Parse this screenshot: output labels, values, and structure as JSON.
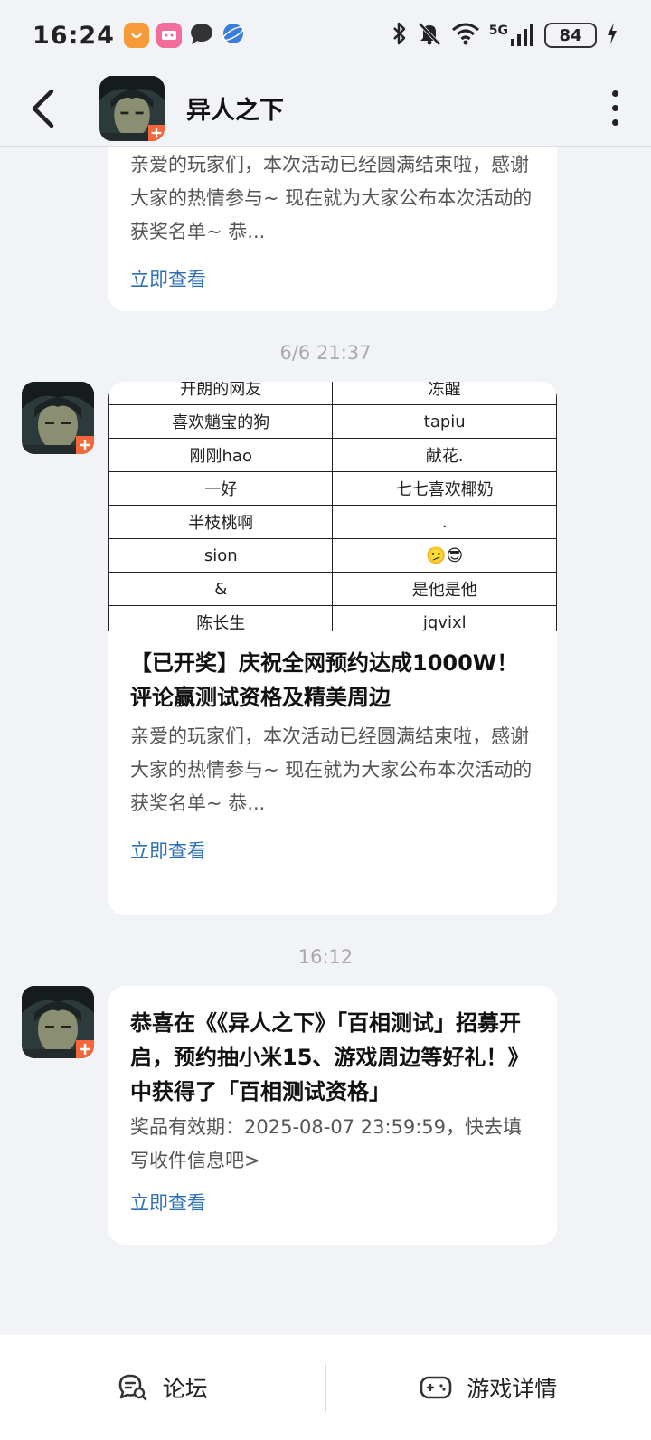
{
  "status_bar": {
    "time": "16:24",
    "signal_label": "5G",
    "battery": "84"
  },
  "header": {
    "title": "异人之下"
  },
  "messages": [
    {
      "desc": "亲爱的玩家们，本次活动已经圆满结束啦，感谢大家的热情参与~ 现在就为大家公布本次活动的获奖名单~ 恭...",
      "link": "立即查看"
    },
    {
      "timestamp": "6/6  21:37",
      "table_rows": [
        [
          "开朗的网友",
          "冻醒"
        ],
        [
          "喜欢魈宝的狗",
          "tapiu"
        ],
        [
          "刚刚hao",
          "献花."
        ],
        [
          "一好",
          "七七喜欢椰奶"
        ],
        [
          "半枝桃啊",
          "."
        ],
        [
          "sion",
          "🫤😎"
        ],
        [
          "&",
          "是他是他"
        ],
        [
          "陈长生",
          "jqvixl"
        ]
      ],
      "title": "【已开奖】庆祝全网预约达成1000W！评论赢测试资格及精美周边",
      "desc": "亲爱的玩家们，本次活动已经圆满结束啦，感谢大家的热情参与~ 现在就为大家公布本次活动的获奖名单~ 恭...",
      "link": "立即查看"
    },
    {
      "timestamp": "16:12",
      "title": "恭喜在《《异人之下》「百相测试」招募开启，预约抽小米15、游戏周边等好礼！》中获得了「百相测试资格」",
      "desc": "奖品有效期：2025-08-07 23:59:59，快去填写收件信息吧>",
      "link": "立即查看"
    }
  ],
  "bottom_bar": {
    "forum_label": "论坛",
    "game_detail_label": "游戏详情"
  },
  "colors": {
    "background": "#f2f3f7",
    "link": "#2c6fb8"
  }
}
